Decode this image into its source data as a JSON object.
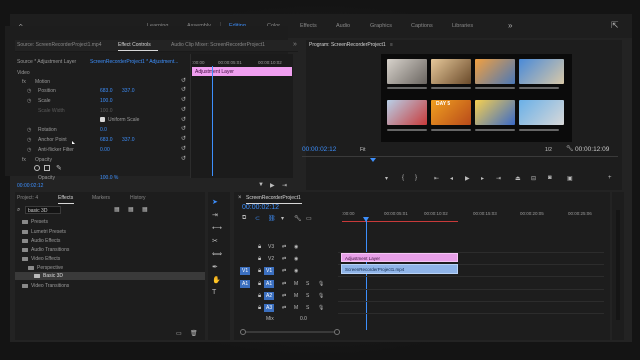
{
  "workspaces": {
    "home_icon": "home-icon",
    "items": [
      "Learning",
      "Assembly",
      "Editing",
      "Color",
      "Effects",
      "Audio",
      "Graphics",
      "Captions",
      "Libraries"
    ],
    "active": "Editing",
    "more": "»"
  },
  "effect_controls": {
    "tabs": [
      "Source: ScreenRecorderProject1.mp4",
      "Effect Controls",
      "Audio Clip Mixer: ScreenRecorderProject1"
    ],
    "tab_more": "»",
    "source_label": "Source * Adjustment Layer",
    "sequence_label": "ScreenRecorderProject1 * Adjustment...",
    "ruler_time1": ":00:00",
    "ruler_time2": "00:00:05:01",
    "ruler_time3": "00:00:10:02",
    "selected_clip": "Adjustment Layer",
    "section_video": "Video",
    "motion": "Motion",
    "position_label": "Position",
    "position_x": "683.0",
    "position_y": "337.0",
    "scale_label": "Scale",
    "scale_value": "100.0",
    "scale_width_label": "Scale Width",
    "scale_width_value": "100.0",
    "uniform_scale": "Uniform Scale",
    "rotation_label": "Rotation",
    "rotation_value": "0.0",
    "anchor_label": "Anchor Point",
    "anchor_x": "683.0",
    "anchor_y": "337.0",
    "antiflicker_label": "Anti-flicker Filter",
    "antiflicker_value": "0.00",
    "opacity": "Opacity",
    "opacity_label": "Opacity",
    "opacity_value": "100.0 %",
    "current_time": "00:00:02:12"
  },
  "program_monitor": {
    "title": "Program: ScreenRecorderProject1",
    "menu_icon": "≡",
    "current_time": "00:00:02:12",
    "fit": "Fit",
    "resolution": "1/2",
    "duration": "00:00:12:09",
    "thumb_labels": [
      "DAY 5"
    ]
  },
  "project": {
    "tabs": [
      "Project: 4",
      "Effects",
      "Markers",
      "History"
    ],
    "search_value": "basic 3D",
    "tree": [
      "Presets",
      "Lumetri Presets",
      "Audio Effects",
      "Audio Transitions",
      "Video Effects",
      "Perspective",
      "Basic 3D",
      "Video Transitions"
    ]
  },
  "timeline": {
    "sequence_tab": "ScreenRecorderProject1",
    "current_time": "00:00:02:12",
    "ruler_ticks": [
      ":00:00",
      "00:00:05:01",
      "00:00:10:02",
      "00:00:15:03",
      "00:00:20:05",
      "00:00:25:06"
    ],
    "tracks_video": [
      "V3",
      "V2",
      "V1"
    ],
    "tracks_audio": [
      "A1",
      "A2",
      "A3"
    ],
    "source_patch_v": "V1",
    "source_patch_a": "A1",
    "mix_label": "Mix",
    "mix_value": "0.0",
    "clip_adjustment": "Adjustment Layer",
    "clip_video": "ScreenRecorderProject1.mp4",
    "mute_label": "M",
    "solo_label": "S"
  }
}
